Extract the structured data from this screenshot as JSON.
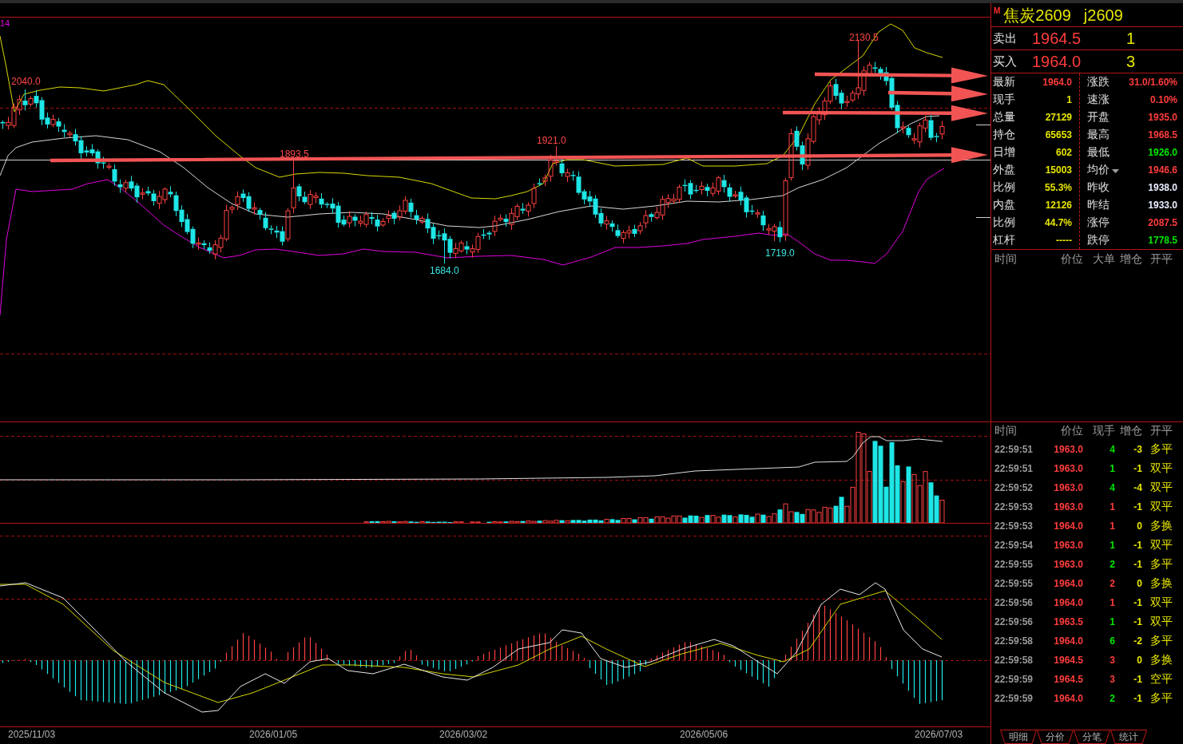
{
  "chart": {
    "indicator_label": "14",
    "price_marks": [
      {
        "text": "2040.0",
        "kind": "high"
      },
      {
        "text": "1893.5",
        "kind": "high"
      },
      {
        "text": "1921.0",
        "kind": "high"
      },
      {
        "text": "2130.5",
        "kind": "high"
      },
      {
        "text": "1684.0",
        "kind": "low"
      },
      {
        "text": "1719.0",
        "kind": "low"
      }
    ],
    "axis_dates": [
      "2025/11/03",
      "2026/01/05",
      "2026/03/02",
      "2026/05/06",
      "2026/07/03"
    ]
  },
  "instrument": {
    "badge": "M",
    "name": "焦炭2609",
    "code": "j2609"
  },
  "order_book": [
    {
      "label": "卖出",
      "price": "1964.5",
      "volume": "1"
    },
    {
      "label": "买入",
      "price": "1964.0",
      "volume": "3"
    }
  ],
  "quote": {
    "left": [
      {
        "label": "最新",
        "value": "1964.0",
        "color": "#ff3c3c"
      },
      {
        "label": "现手",
        "value": "1",
        "color": "#e6e600"
      },
      {
        "label": "总量",
        "value": "27129",
        "color": "#e6e600"
      },
      {
        "label": "持仓",
        "value": "65653",
        "color": "#e6e600"
      },
      {
        "label": "日增",
        "value": "602",
        "color": "#e6e600"
      },
      {
        "label": "外盘",
        "value": "15003",
        "color": "#e6e600"
      },
      {
        "label": "比例",
        "value": "55.3%",
        "color": "#e6e600"
      },
      {
        "label": "内盘",
        "value": "12126",
        "color": "#e6e600"
      },
      {
        "label": "比例",
        "value": "44.7%",
        "color": "#e6e600"
      },
      {
        "label": "杠杆",
        "value": "-----",
        "color": "#e6e600"
      }
    ],
    "right": [
      {
        "label": "涨跌",
        "value": "31.0/1.60%",
        "color": "#ff3c3c",
        "kind": "plain"
      },
      {
        "label": "速涨",
        "value": "0.10%",
        "color": "#ff3c3c",
        "kind": "plain"
      },
      {
        "label": "开盘",
        "value": "1935.0",
        "color": "#ff3c3c",
        "kind": "plain"
      },
      {
        "label": "最高",
        "value": "1968.5",
        "color": "#ff3c3c",
        "kind": "plain"
      },
      {
        "label": "最低",
        "value": "1926.0",
        "color": "#00e600",
        "kind": "plain"
      },
      {
        "label": "均价",
        "value": "1946.6",
        "color": "#ff3c3c",
        "kind": "dropdown"
      },
      {
        "label": "昨收",
        "value": "1938.0",
        "color": "#e8eeff",
        "kind": "plain"
      },
      {
        "label": "昨结",
        "value": "1933.0",
        "color": "#e8eeff",
        "kind": "plain"
      },
      {
        "label": "涨停",
        "value": "2087.5",
        "color": "#ff3c3c",
        "kind": "plain"
      },
      {
        "label": "跌停",
        "value": "1778.5",
        "color": "#00e600",
        "kind": "plain"
      }
    ]
  },
  "tick_header": [
    "时间",
    "价位",
    "大单",
    "增仓",
    "开平"
  ],
  "trades": {
    "columns": [
      "时间",
      "价位",
      "现手",
      "增仓",
      "开平"
    ],
    "rows": [
      {
        "time": "22:59:51",
        "price": "1963.0",
        "volume": "4",
        "color": "#00e600",
        "change": "-3",
        "type": "多平"
      },
      {
        "time": "22:59:51",
        "price": "1963.0",
        "volume": "1",
        "color": "#00e600",
        "change": "-1",
        "type": "双平"
      },
      {
        "time": "22:59:52",
        "price": "1963.0",
        "volume": "4",
        "color": "#00e600",
        "change": "-4",
        "type": "双平"
      },
      {
        "time": "22:59:53",
        "price": "1963.0",
        "volume": "1",
        "color": "#ff3c3c",
        "change": "-1",
        "type": "双平"
      },
      {
        "time": "22:59:53",
        "price": "1964.0",
        "volume": "1",
        "color": "#ff3c3c",
        "change": "0",
        "type": "多换"
      },
      {
        "time": "22:59:54",
        "price": "1963.0",
        "volume": "1",
        "color": "#00e600",
        "change": "-1",
        "type": "双平"
      },
      {
        "time": "22:59:55",
        "price": "1963.0",
        "volume": "2",
        "color": "#00e600",
        "change": "-1",
        "type": "多平"
      },
      {
        "time": "22:59:55",
        "price": "1964.0",
        "volume": "2",
        "color": "#ff3c3c",
        "change": "0",
        "type": "多换"
      },
      {
        "time": "22:59:56",
        "price": "1964.0",
        "volume": "1",
        "color": "#ff3c3c",
        "change": "-1",
        "type": "双平"
      },
      {
        "time": "22:59:56",
        "price": "1963.5",
        "volume": "1",
        "color": "#00e600",
        "change": "-1",
        "type": "双平"
      },
      {
        "time": "22:59:58",
        "price": "1964.0",
        "volume": "6",
        "color": "#00e600",
        "change": "-2",
        "type": "多平"
      },
      {
        "time": "22:59:58",
        "price": "1964.5",
        "volume": "3",
        "color": "#ff3c3c",
        "change": "0",
        "type": "多换"
      },
      {
        "time": "22:59:59",
        "price": "1964.5",
        "volume": "3",
        "color": "#ff3c3c",
        "change": "-1",
        "type": "空平"
      },
      {
        "time": "22:59:59",
        "price": "1964.0",
        "volume": "2",
        "color": "#00e600",
        "change": "-1",
        "type": "多平"
      }
    ]
  },
  "tabs": [
    "明细",
    "分价",
    "分笔",
    "统计"
  ]
}
